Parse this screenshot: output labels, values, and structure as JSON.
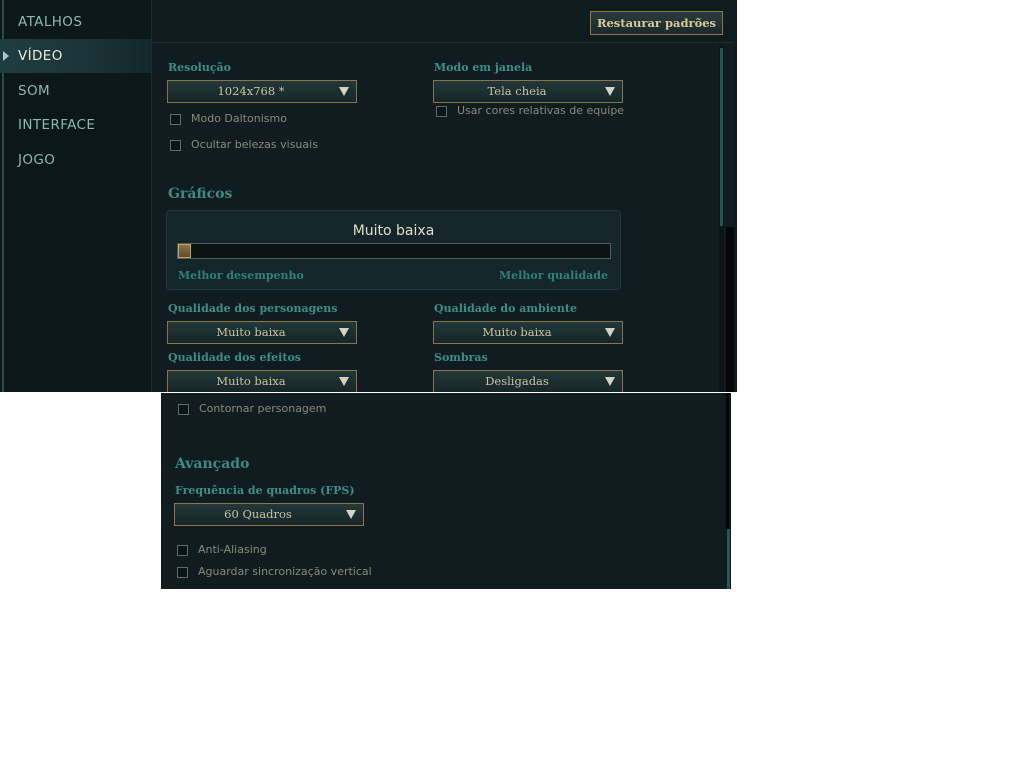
{
  "nav": {
    "items": [
      {
        "label": "ATALHOS"
      },
      {
        "label": "VÍDEO"
      },
      {
        "label": "SOM"
      },
      {
        "label": "INTERFACE"
      },
      {
        "label": "JOGO"
      }
    ],
    "active_index": 1
  },
  "toolbar": {
    "restore_label": "Restaurar padrões"
  },
  "display": {
    "resolution_label": "Resolução",
    "resolution_value": "1024x768 *",
    "window_mode_label": "Modo em janela",
    "window_mode_value": "Tela cheia",
    "team_colors_label": "Usar cores relativas de equipe",
    "colorblind_label": "Modo Daltonismo",
    "hide_eyecandy_label": "Ocultar belezas visuais"
  },
  "graphics": {
    "title": "Gráficos",
    "preset_value": "Muito baixa",
    "slider_fraction": 0,
    "left_hint": "Melhor desempenho",
    "right_hint": "Melhor qualidade",
    "character_quality_label": "Qualidade dos personagens",
    "character_quality_value": "Muito baixa",
    "environment_quality_label": "Qualidade do ambiente",
    "environment_quality_value": "Muito baixa",
    "effects_quality_label": "Qualidade dos efeitos",
    "effects_quality_value": "Muito baixa",
    "shadows_label": "Sombras",
    "shadows_value": "Desligadas",
    "outline_label": "Contornar personagem"
  },
  "advanced": {
    "title": "Avançado",
    "fps_label": "Frequência de quadros (FPS)",
    "fps_value": "60 Quadros",
    "antialiasing_label": "Anti-Aliasing",
    "vsync_label": "Aguardar sincronização vertical"
  },
  "colors": {
    "accent_teal": "#3d8a86",
    "gold_border": "#8a7548",
    "background": "#101c1f"
  }
}
